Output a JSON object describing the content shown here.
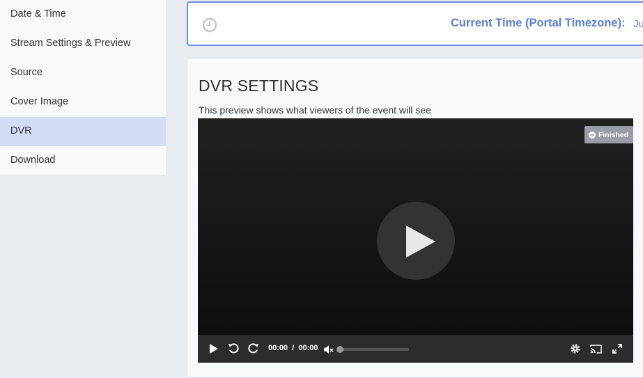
{
  "sidebar": {
    "items": [
      {
        "label": "Date & Time"
      },
      {
        "label": "Stream Settings & Preview"
      },
      {
        "label": "Source"
      },
      {
        "label": "Cover Image"
      },
      {
        "label": "DVR",
        "active": true
      },
      {
        "label": "Download"
      }
    ]
  },
  "time_panel": {
    "label": "Current Time (Portal Timezone):",
    "value": "Ju"
  },
  "dvr": {
    "title": "DVR SETTINGS",
    "description": "This preview shows what viewers of the event will see"
  },
  "player": {
    "status_badge": "Finished",
    "current_time": "00:00",
    "separator": "/",
    "duration": "00:00",
    "volume_level": 0
  },
  "colors": {
    "accent": "#5b7fd6",
    "active_item": "#d3dcf6",
    "badge": "#9a9ca8",
    "player_bg": "#1a1a1a"
  },
  "icons": {
    "clock": "clock-icon",
    "badge": "minus-circle-icon",
    "play": "play-icon",
    "replay": "rewind-icon",
    "forward": "forward-icon",
    "mute": "mute-icon",
    "settings": "gear-icon",
    "cast": "cast-icon",
    "fullscreen": "fullscreen-icon"
  }
}
